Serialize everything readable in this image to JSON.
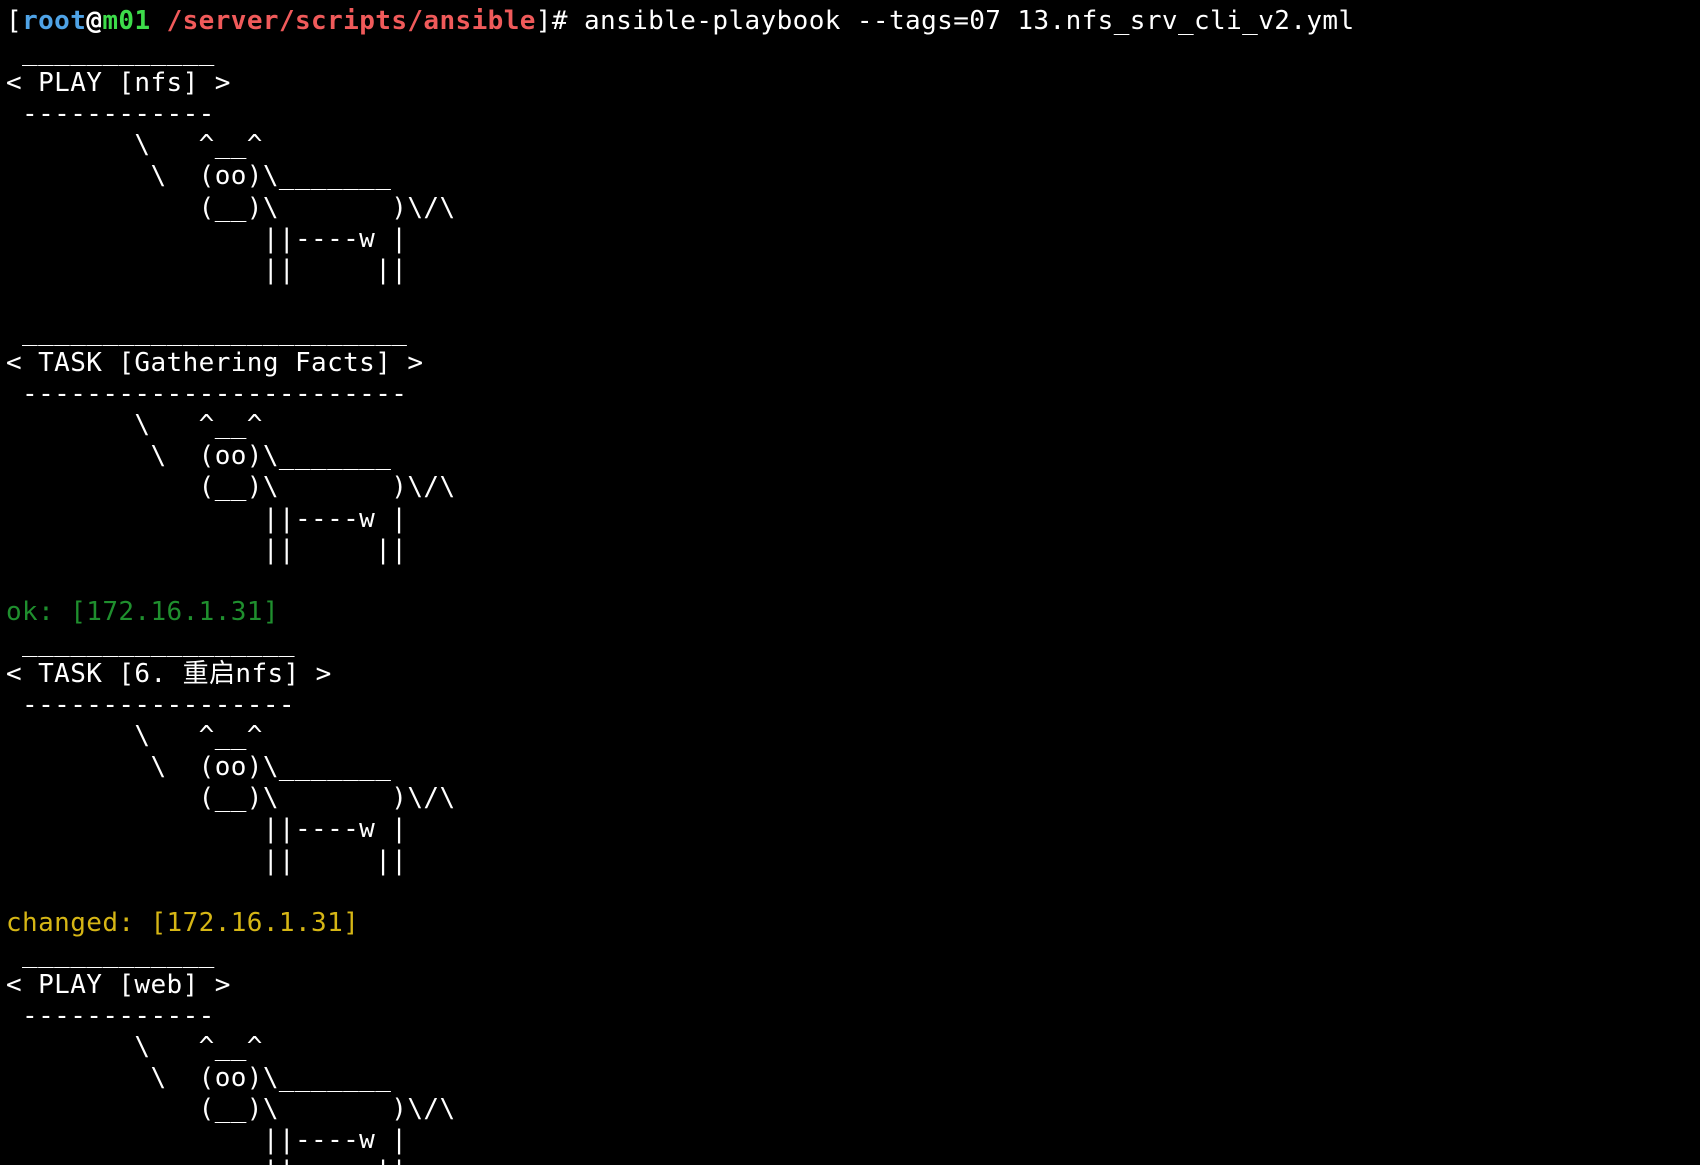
{
  "theme": {
    "background": "#000000",
    "default": "#ffffff",
    "user": "#4fa3e6",
    "at": "#ffffff",
    "host": "#3ddc4a",
    "path": "#f05a5a",
    "ok": "#1f8f2e",
    "changed": "#d6b615"
  },
  "prompt": {
    "open": "[",
    "user": "root",
    "at": "@",
    "host": "m01",
    "path": " /server/scripts/ansible",
    "close": "]# ",
    "command": "ansible-playbook --tags=07 13.nfs_srv_cli_v2.yml"
  },
  "lines": [
    [
      {
        "t": " ____________",
        "c": "default"
      }
    ],
    [
      {
        "t": "< PLAY [nfs] >",
        "c": "default"
      }
    ],
    [
      {
        "t": " ------------",
        "c": "default"
      }
    ],
    [
      {
        "t": "        \\   ^__^",
        "c": "default"
      }
    ],
    [
      {
        "t": "         \\  (oo)\\_______",
        "c": "default"
      }
    ],
    [
      {
        "t": "            (__)\\       )\\/\\",
        "c": "default"
      }
    ],
    [
      {
        "t": "                ||----w |",
        "c": "default"
      }
    ],
    [
      {
        "t": "                ||     ||",
        "c": "default"
      }
    ],
    [
      {
        "t": "",
        "c": "default"
      }
    ],
    [
      {
        "t": " ________________________",
        "c": "default"
      }
    ],
    [
      {
        "t": "< TASK [Gathering Facts] >",
        "c": "default"
      }
    ],
    [
      {
        "t": " ------------------------",
        "c": "default"
      }
    ],
    [
      {
        "t": "        \\   ^__^",
        "c": "default"
      }
    ],
    [
      {
        "t": "         \\  (oo)\\_______",
        "c": "default"
      }
    ],
    [
      {
        "t": "            (__)\\       )\\/\\",
        "c": "default"
      }
    ],
    [
      {
        "t": "                ||----w |",
        "c": "default"
      }
    ],
    [
      {
        "t": "                ||     ||",
        "c": "default"
      }
    ],
    [
      {
        "t": "",
        "c": "default"
      }
    ],
    [
      {
        "t": "ok: [172.16.1.31]",
        "c": "ok"
      }
    ],
    [
      {
        "t": " _________________",
        "c": "default"
      }
    ],
    [
      {
        "t": "< TASK [6. 重启nfs] >",
        "c": "default"
      }
    ],
    [
      {
        "t": " -----------------",
        "c": "default"
      }
    ],
    [
      {
        "t": "        \\   ^__^",
        "c": "default"
      }
    ],
    [
      {
        "t": "         \\  (oo)\\_______",
        "c": "default"
      }
    ],
    [
      {
        "t": "            (__)\\       )\\/\\",
        "c": "default"
      }
    ],
    [
      {
        "t": "                ||----w |",
        "c": "default"
      }
    ],
    [
      {
        "t": "                ||     ||",
        "c": "default"
      }
    ],
    [
      {
        "t": "",
        "c": "default"
      }
    ],
    [
      {
        "t": "changed: [172.16.1.31]",
        "c": "changed"
      }
    ],
    [
      {
        "t": " ____________",
        "c": "default"
      }
    ],
    [
      {
        "t": "< PLAY [web] >",
        "c": "default"
      }
    ],
    [
      {
        "t": " ------------",
        "c": "default"
      }
    ],
    [
      {
        "t": "        \\   ^__^",
        "c": "default"
      }
    ],
    [
      {
        "t": "         \\  (oo)\\_______",
        "c": "default"
      }
    ],
    [
      {
        "t": "            (__)\\       )\\/\\",
        "c": "default"
      }
    ],
    [
      {
        "t": "                ||----w |",
        "c": "default"
      }
    ],
    [
      {
        "t": "                ||     ||",
        "c": "default"
      }
    ]
  ]
}
